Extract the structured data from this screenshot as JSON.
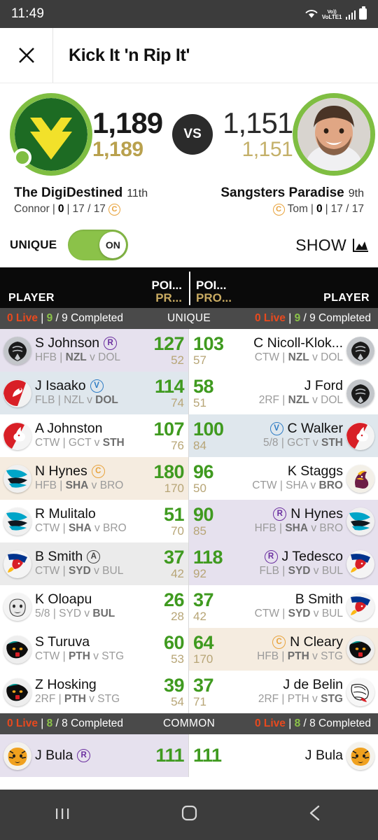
{
  "status_bar": {
    "time": "11:49",
    "network": "VoLTE1",
    "wifi_icon": "wifi-icon",
    "signal_icon": "signal-bars-icon",
    "battery_icon": "battery-icon"
  },
  "app_bar": {
    "close_icon": "close-icon",
    "title": "Kick It 'n Rip It'"
  },
  "matchup": {
    "home": {
      "score": "1,189",
      "projected": "1,189",
      "team_name": "The DigiDestined",
      "rank": "11th",
      "manager": "Connor",
      "trades": "0",
      "players": "17 / 17",
      "captain_badge": "C",
      "avatar": "team-crest-green-chevron",
      "online": true
    },
    "vs_label": "VS",
    "away": {
      "score": "1,151",
      "projected": "1,151",
      "team_name": "Sangsters Paradise",
      "rank": "9th",
      "manager": "Tom",
      "trades": "0",
      "players": "17 / 17",
      "captain_badge": "C",
      "avatar": "user-photo-avatar"
    }
  },
  "controls": {
    "unique_label": "UNIQUE",
    "toggle_state": "ON",
    "show_label": "SHOW",
    "show_icon": "chart-icon"
  },
  "table_header": {
    "player_left": "PLAYER",
    "points_left_1": "POI...",
    "points_left_2": "PR...",
    "points_right_1": "POI...",
    "points_right_2": "PRO...",
    "player_right": "PLAYER"
  },
  "unique_status": {
    "left_live": "0 Live",
    "left_count": "9",
    "left_total": "/ 9 Completed",
    "label": "UNIQUE",
    "right_live": "0 Live",
    "right_count": "9",
    "right_total": "/ 9 Completed"
  },
  "common_status": {
    "left_live": "0 Live",
    "left_count": "8",
    "left_total": "/ 8 Completed",
    "label": "COMMON",
    "right_live": "0 Live",
    "right_count": "8",
    "right_total": "/ 8 Completed"
  },
  "unique_rows": [
    {
      "tint": "#e6e1ee",
      "left": {
        "logo": "warriors",
        "name": "S Johnson",
        "badge": "R",
        "badge_type": "R",
        "pos": "HFB",
        "team": "NZL",
        "opp": "DOL",
        "team_bold": true,
        "points": "127",
        "proj": "52"
      },
      "right": {
        "logo": "warriors",
        "name": "C Nicoll-Klok...",
        "badge": "",
        "badge_type": "",
        "pos": "CTW",
        "team": "NZL",
        "opp": "DOL",
        "team_bold": true,
        "points": "103",
        "proj": "57",
        "tint": "#ffffff"
      }
    },
    {
      "tint": "#dfe7ed",
      "left": {
        "logo": "dolphins",
        "name": "J Isaako",
        "badge": "V",
        "badge_type": "V",
        "pos": "FLB",
        "team": "NZL",
        "opp": "DOL",
        "team_bold": false,
        "points": "114",
        "proj": "74"
      },
      "right": {
        "logo": "warriors",
        "name": "J Ford",
        "badge": "",
        "badge_type": "",
        "pos": "2RF",
        "team": "NZL",
        "opp": "DOL",
        "team_bold": true,
        "points": "58",
        "proj": "51",
        "tint": "#ffffff"
      }
    },
    {
      "tint": "#ffffff",
      "left": {
        "logo": "rabbitohs",
        "name": "A Johnston",
        "badge": "",
        "badge_type": "",
        "pos": "CTW",
        "team": "GCT",
        "opp": "STH",
        "team_bold": false,
        "points": "107",
        "proj": "76"
      },
      "right": {
        "logo": "rabbitohs",
        "name": "C Walker",
        "badge": "V",
        "badge_type": "V",
        "pos": "5/8",
        "team": "GCT",
        "opp": "STH",
        "team_bold": false,
        "points": "100",
        "proj": "84",
        "tint": "#dfe7ed"
      }
    },
    {
      "tint": "#f5ece0",
      "left": {
        "logo": "sharks",
        "name": "N Hynes",
        "badge": "C",
        "badge_type": "C",
        "pos": "HFB",
        "team": "SHA",
        "opp": "BRO",
        "team_bold": true,
        "points": "180",
        "proj": "170"
      },
      "right": {
        "logo": "broncos",
        "name": "K Staggs",
        "badge": "",
        "badge_type": "",
        "pos": "CTW",
        "team": "SHA",
        "opp": "BRO",
        "team_bold": false,
        "points": "96",
        "proj": "50",
        "tint": "#ffffff"
      }
    },
    {
      "tint": "#ffffff",
      "left": {
        "logo": "sharks",
        "name": "R Mulitalo",
        "badge": "",
        "badge_type": "",
        "pos": "CTW",
        "team": "SHA",
        "opp": "BRO",
        "team_bold": true,
        "points": "51",
        "proj": "70"
      },
      "right": {
        "logo": "sharks",
        "name": "N Hynes",
        "badge": "R",
        "badge_type": "R",
        "pos": "HFB",
        "team": "SHA",
        "opp": "BRO",
        "team_bold": true,
        "points": "90",
        "proj": "85",
        "tint": "#e6e1ee"
      }
    },
    {
      "tint": "#ebebeb",
      "left": {
        "logo": "roosters",
        "name": "B Smith",
        "badge": "A",
        "badge_type": "A",
        "pos": "CTW",
        "team": "SYD",
        "opp": "BUL",
        "team_bold": true,
        "points": "37",
        "proj": "42"
      },
      "right": {
        "logo": "roosters",
        "name": "J Tedesco",
        "badge": "R",
        "badge_type": "R",
        "pos": "FLB",
        "team": "SYD",
        "opp": "BUL",
        "team_bold": true,
        "points": "118",
        "proj": "92",
        "tint": "#e6e1ee"
      }
    },
    {
      "tint": "#ffffff",
      "left": {
        "logo": "bulldogs",
        "name": "K Oloapu",
        "badge": "",
        "badge_type": "",
        "pos": "5/8",
        "team": "SYD",
        "opp": "BUL",
        "team_bold": false,
        "points": "26",
        "proj": "28"
      },
      "right": {
        "logo": "roosters",
        "name": "B Smith",
        "badge": "",
        "badge_type": "",
        "pos": "CTW",
        "team": "SYD",
        "opp": "BUL",
        "team_bold": true,
        "points": "37",
        "proj": "42",
        "tint": "#ffffff"
      }
    },
    {
      "tint": "#ffffff",
      "left": {
        "logo": "panthers",
        "name": "S Turuva",
        "badge": "",
        "badge_type": "",
        "pos": "CTW",
        "team": "PTH",
        "opp": "STG",
        "team_bold": true,
        "points": "60",
        "proj": "53"
      },
      "right": {
        "logo": "panthers",
        "name": "N Cleary",
        "badge": "C",
        "badge_type": "C",
        "pos": "HFB",
        "team": "PTH",
        "opp": "STG",
        "team_bold": true,
        "points": "64",
        "proj": "170",
        "tint": "#f5ece0"
      }
    },
    {
      "tint": "#ffffff",
      "left": {
        "logo": "panthers",
        "name": "Z Hosking",
        "badge": "",
        "badge_type": "",
        "pos": "2RF",
        "team": "PTH",
        "opp": "STG",
        "team_bold": true,
        "points": "39",
        "proj": "54"
      },
      "right": {
        "logo": "dragons",
        "name": "J de Belin",
        "badge": "",
        "badge_type": "",
        "pos": "2RF",
        "team": "PTH",
        "opp": "STG",
        "team_bold": false,
        "points": "37",
        "proj": "71",
        "tint": "#ffffff"
      }
    }
  ],
  "common_rows": [
    {
      "tint": "#e6e1ee",
      "left": {
        "logo": "tigers",
        "name": "J Bula",
        "badge": "R",
        "badge_type": "R",
        "points": "111"
      },
      "right": {
        "logo": "tigers",
        "name": "J Bula",
        "badge": "",
        "badge_type": "",
        "points": "111",
        "tint": "#ffffff"
      }
    }
  ],
  "nav_bar": {
    "recents_icon": "recents-icon",
    "home_icon": "home-icon",
    "back_icon": "back-icon"
  },
  "colors": {
    "accent_green": "#8bc249",
    "points_green": "#3f9a1f",
    "projected_gold": "#b9a14e",
    "live_red": "#e8491e",
    "header_black": "#0a0a0a"
  }
}
